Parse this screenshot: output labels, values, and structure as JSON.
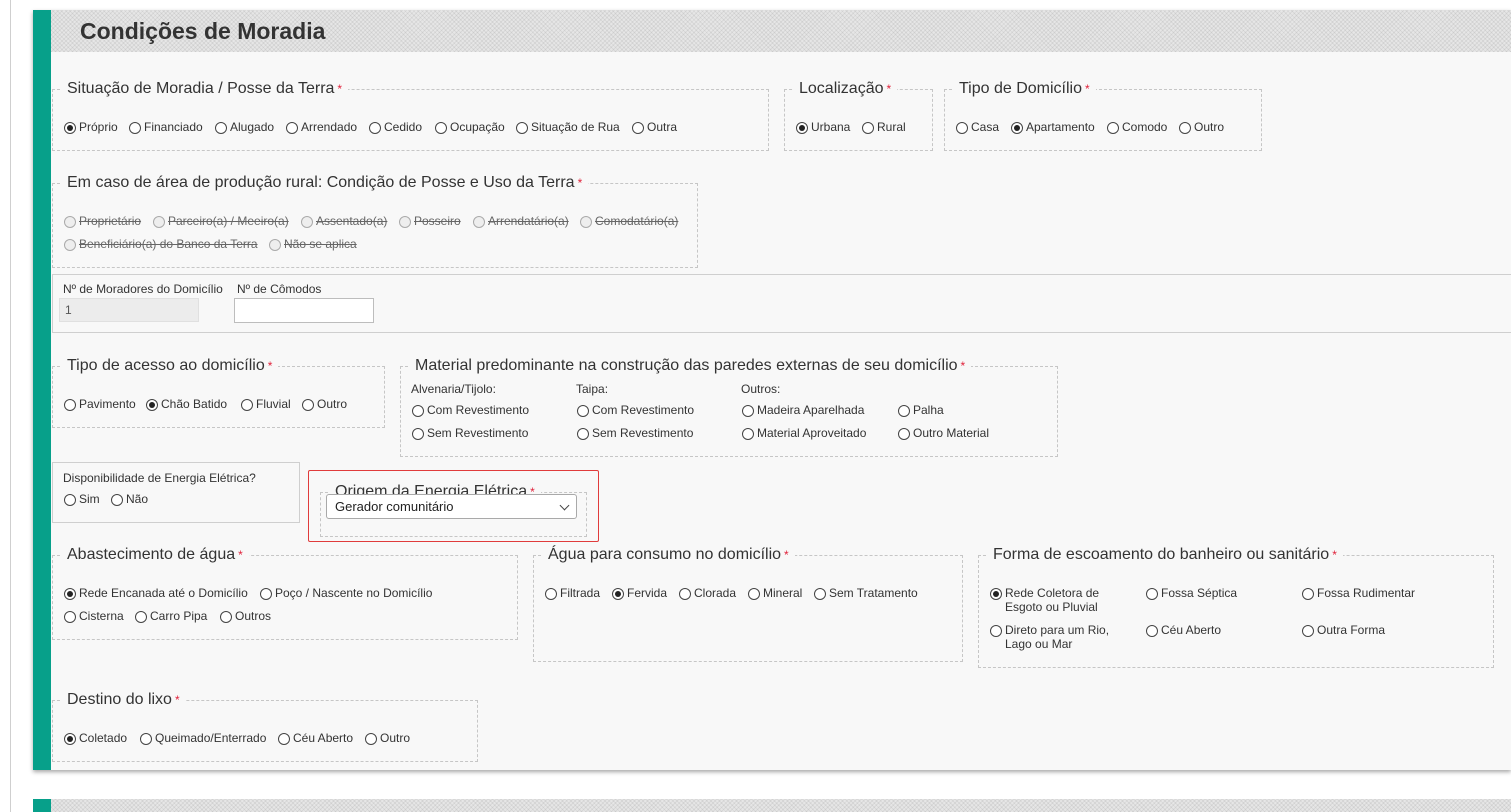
{
  "section": {
    "title": "Condições de Moradia"
  },
  "required_mark": "*",
  "moradia": {
    "legend": "Situação de Moradia / Posse da Terra",
    "options": [
      {
        "label": "Próprio",
        "checked": true
      },
      {
        "label": "Financiado",
        "checked": false
      },
      {
        "label": "Alugado",
        "checked": false
      },
      {
        "label": "Arrendado",
        "checked": false
      },
      {
        "label": "Cedido",
        "checked": false
      },
      {
        "label": "Ocupação",
        "checked": false
      },
      {
        "label": "Situação de Rua",
        "checked": false
      },
      {
        "label": "Outra",
        "checked": false
      }
    ]
  },
  "localizacao": {
    "legend": "Localização",
    "options": [
      {
        "label": "Urbana",
        "checked": true
      },
      {
        "label": "Rural",
        "checked": false
      }
    ]
  },
  "tipo_domicilio": {
    "legend": "Tipo de Domicílio",
    "options": [
      {
        "label": "Casa",
        "checked": false
      },
      {
        "label": "Apartamento",
        "checked": true
      },
      {
        "label": "Comodo",
        "checked": false
      },
      {
        "label": "Outro",
        "checked": false
      }
    ]
  },
  "rural": {
    "legend": "Em caso de área de produção rural: Condição de Posse e Uso da Terra",
    "options": [
      {
        "label": "Proprietário"
      },
      {
        "label": "Parceiro(a) / Meeiro(a)"
      },
      {
        "label": "Assentado(a)"
      },
      {
        "label": "Posseiro"
      },
      {
        "label": "Arrendatário(a)"
      },
      {
        "label": "Comodatário(a)"
      },
      {
        "label": "Beneficiário(a) do Banco da Terra"
      },
      {
        "label": "Não se aplica"
      }
    ]
  },
  "moradores": {
    "label": "Nº de Moradores do Domicílio",
    "value": "1"
  },
  "comodos": {
    "label": "Nº de Cômodos",
    "value": ""
  },
  "acesso": {
    "legend": "Tipo de acesso ao domicílio",
    "options": [
      {
        "label": "Pavimento",
        "checked": false
      },
      {
        "label": "Chão Batido",
        "checked": true
      },
      {
        "label": "Fluvial",
        "checked": false
      },
      {
        "label": "Outro",
        "checked": false
      }
    ]
  },
  "material": {
    "legend": "Material predominante na construção das paredes externas de seu domicílio",
    "groups": [
      {
        "label": "Alvenaria/Tijolo:",
        "options": [
          "Com Revestimento",
          "Sem Revestimento"
        ]
      },
      {
        "label": "Taipa:",
        "options": [
          "Com Revestimento",
          "Sem Revestimento"
        ]
      },
      {
        "label": "Outros:",
        "options": [
          "Madeira Aparelhada",
          "Material Aproveitado"
        ]
      },
      {
        "label": "",
        "options": [
          "Palha",
          "Outro Material"
        ]
      }
    ]
  },
  "energia": {
    "label": "Disponibilidade de Energia Elétrica?",
    "options": [
      {
        "label": "Sim",
        "checked": false
      },
      {
        "label": "Não",
        "checked": false
      }
    ]
  },
  "origem_energia": {
    "legend": "Origem da Energia Elétrica",
    "selected": "Gerador comunitário"
  },
  "agua_abastecimento": {
    "legend": "Abastecimento de água",
    "options": [
      {
        "label": "Rede Encanada até o Domicílio",
        "checked": true
      },
      {
        "label": "Poço / Nascente no Domicílio",
        "checked": false
      },
      {
        "label": "Cisterna",
        "checked": false
      },
      {
        "label": "Carro Pipa",
        "checked": false
      },
      {
        "label": "Outros",
        "checked": false
      }
    ]
  },
  "agua_consumo": {
    "legend": "Água para consumo no domicílio",
    "options": [
      {
        "label": "Filtrada",
        "checked": false
      },
      {
        "label": "Fervida",
        "checked": true
      },
      {
        "label": "Clorada",
        "checked": false
      },
      {
        "label": "Mineral",
        "checked": false
      },
      {
        "label": "Sem Tratamento",
        "checked": false
      }
    ]
  },
  "escoamento": {
    "legend": "Forma de escoamento do banheiro ou sanitário",
    "options": [
      {
        "label": "Rede Coletora de Esgoto ou Pluvial",
        "checked": true
      },
      {
        "label": "Fossa Séptica",
        "checked": false
      },
      {
        "label": "Fossa Rudimentar",
        "checked": false
      },
      {
        "label": "Direto para um Rio, Lago ou Mar",
        "checked": false
      },
      {
        "label": "Céu Aberto",
        "checked": false
      },
      {
        "label": "Outra Forma",
        "checked": false
      }
    ]
  },
  "lixo": {
    "legend": "Destino do lixo",
    "options": [
      {
        "label": "Coletado",
        "checked": true
      },
      {
        "label": "Queimado/Enterrado",
        "checked": false
      },
      {
        "label": "Céu Aberto",
        "checked": false
      },
      {
        "label": "Outro",
        "checked": false
      }
    ]
  }
}
